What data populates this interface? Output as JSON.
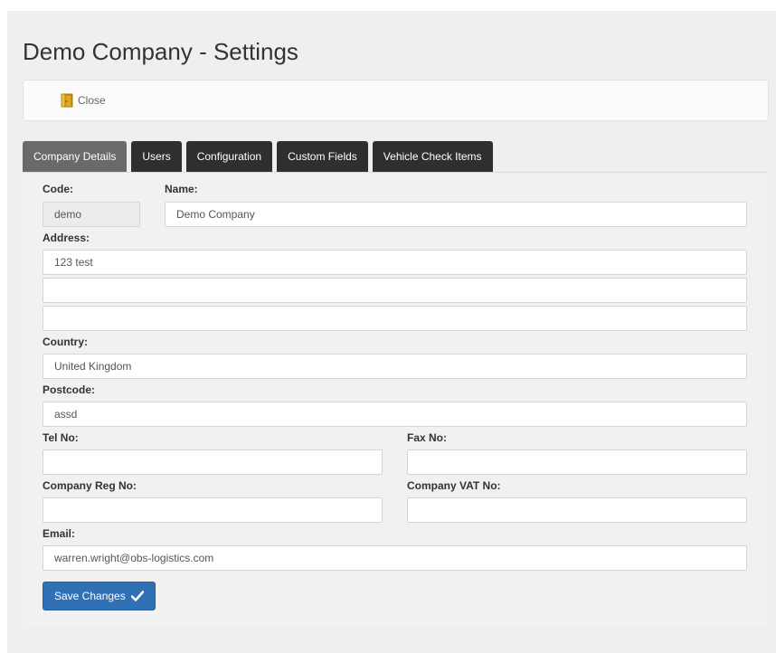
{
  "page": {
    "title": "Demo Company - Settings"
  },
  "toolbar": {
    "close_label": "Close"
  },
  "tabs": [
    {
      "label": "Company Details",
      "active": true
    },
    {
      "label": "Users",
      "active": false
    },
    {
      "label": "Configuration",
      "active": false
    },
    {
      "label": "Custom Fields",
      "active": false
    },
    {
      "label": "Vehicle Check Items",
      "active": false
    }
  ],
  "form": {
    "code": {
      "label": "Code:",
      "value": "demo"
    },
    "name": {
      "label": "Name:",
      "value": "Demo Company"
    },
    "address": {
      "label": "Address:",
      "line1": "123 test",
      "line2": "",
      "line3": ""
    },
    "country": {
      "label": "Country:",
      "value": "United Kingdom"
    },
    "postcode": {
      "label": "Postcode:",
      "value": "assd"
    },
    "tel": {
      "label": "Tel No:",
      "value": ""
    },
    "fax": {
      "label": "Fax No:",
      "value": ""
    },
    "reg": {
      "label": "Company Reg No:",
      "value": ""
    },
    "vat": {
      "label": "Company VAT No:",
      "value": ""
    },
    "email": {
      "label": "Email:",
      "value": "warren.wright@obs-logistics.com"
    },
    "save_label": "Save Changes"
  },
  "icons": {
    "close": "door-icon",
    "save": "check-icon"
  },
  "colors": {
    "tab_bg": "#2f2f2f",
    "tab_active_bg": "#6a6a6a",
    "save_button": "#3071b5"
  }
}
